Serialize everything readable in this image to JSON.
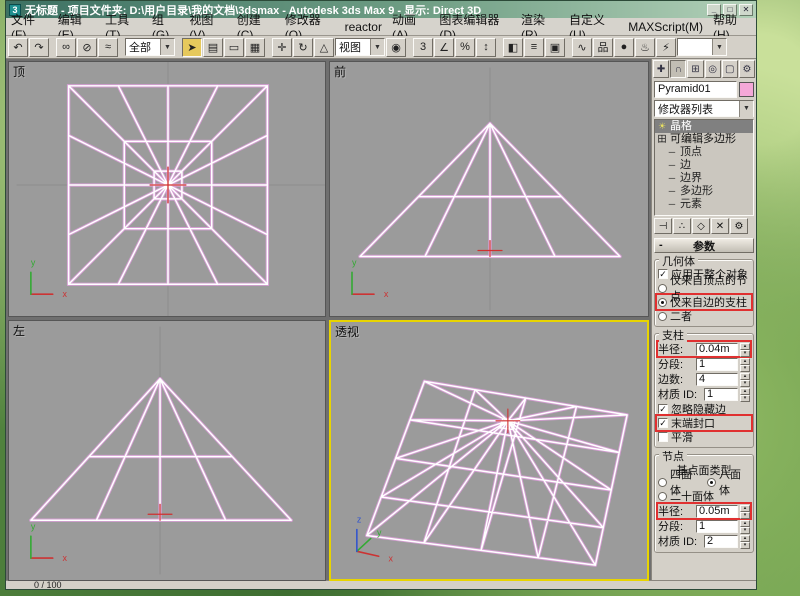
{
  "titlebar": {
    "title": "无标题 - 项目文件夹: D:\\用户目录\\我的文档\\3dsmax    - Autodesk 3ds Max 9 -   显示: Direct 3D",
    "app_icon_glyph": "3"
  },
  "menus": [
    "文件(F)",
    "编辑(E)",
    "工具(T)",
    "组(G)",
    "视图(V)",
    "创建(C)",
    "修改器(O)",
    "reactor",
    "动画(A)",
    "图表编辑器(D)",
    "渲染(R)",
    "自定义(U)",
    "MAXScript(M)",
    "帮助(H)"
  ],
  "toolbar": {
    "items": [
      {
        "type": "btn",
        "name": "undo-icon",
        "glyph": "↶"
      },
      {
        "type": "btn",
        "name": "redo-icon",
        "glyph": "↷"
      },
      {
        "type": "sep"
      },
      {
        "type": "btn",
        "name": "select-link-icon",
        "glyph": "∞"
      },
      {
        "type": "btn",
        "name": "unlink-icon",
        "glyph": "⊘"
      },
      {
        "type": "btn",
        "name": "bind-spacewarp-icon",
        "glyph": "≈"
      },
      {
        "type": "sep"
      },
      {
        "type": "drop",
        "name": "selection-set-dropdown",
        "value": "全部"
      },
      {
        "type": "sep"
      },
      {
        "type": "btn",
        "name": "select-object-icon",
        "glyph": "➤",
        "active": true
      },
      {
        "type": "btn",
        "name": "select-by-name-icon",
        "glyph": "▤"
      },
      {
        "type": "btn",
        "name": "rect-region-icon",
        "glyph": "▭"
      },
      {
        "type": "btn",
        "name": "crossing-icon",
        "glyph": "▦"
      },
      {
        "type": "sep"
      },
      {
        "type": "btn",
        "name": "select-move-icon",
        "glyph": "✛"
      },
      {
        "type": "btn",
        "name": "select-rotate-icon",
        "glyph": "↻"
      },
      {
        "type": "btn",
        "name": "select-scale-icon",
        "glyph": "△"
      },
      {
        "type": "drop",
        "name": "ref-coord-dropdown",
        "value": "视图"
      },
      {
        "type": "btn",
        "name": "use-center-icon",
        "glyph": "◉"
      },
      {
        "type": "sep"
      },
      {
        "type": "btn",
        "name": "snap-3d-icon",
        "glyph": "3"
      },
      {
        "type": "btn",
        "name": "angle-snap-icon",
        "glyph": "∠"
      },
      {
        "type": "btn",
        "name": "percent-snap-icon",
        "glyph": "%"
      },
      {
        "type": "btn",
        "name": "spinner-snap-icon",
        "glyph": "↕"
      },
      {
        "type": "sep"
      },
      {
        "type": "btn",
        "name": "mirror-icon",
        "glyph": "◧"
      },
      {
        "type": "btn",
        "name": "align-icon",
        "glyph": "≡"
      },
      {
        "type": "btn",
        "name": "layer-manager-icon",
        "glyph": "▣"
      },
      {
        "type": "sep"
      },
      {
        "type": "btn",
        "name": "curve-editor-icon",
        "glyph": "∿"
      },
      {
        "type": "btn",
        "name": "schematic-view-icon",
        "glyph": "品"
      },
      {
        "type": "btn",
        "name": "material-editor-icon",
        "glyph": "●"
      },
      {
        "type": "btn",
        "name": "render-scene-icon",
        "glyph": "♨"
      },
      {
        "type": "btn",
        "name": "quick-render-icon",
        "glyph": "⚡"
      },
      {
        "type": "drop",
        "name": "render-type-dropdown",
        "value": ""
      }
    ]
  },
  "viewports": [
    {
      "label": "顶"
    },
    {
      "label": "前"
    },
    {
      "label": "左"
    },
    {
      "label": "透视"
    }
  ],
  "panel": {
    "tabs": [
      {
        "name": "tab-create",
        "glyph": "✚"
      },
      {
        "name": "tab-modify",
        "glyph": "∩",
        "active": true
      },
      {
        "name": "tab-hierarchy",
        "glyph": "⊞"
      },
      {
        "name": "tab-motion",
        "glyph": "◎"
      },
      {
        "name": "tab-display",
        "glyph": "▢"
      },
      {
        "name": "tab-utilities",
        "glyph": "⚙"
      }
    ],
    "object_name": "Pyramid01",
    "modifier_list_label": "修改器列表",
    "stack": [
      {
        "label": "晶格",
        "icon": "bulb",
        "selected": true,
        "indent": 0
      },
      {
        "label": "可编辑多边形",
        "icon": "expand",
        "indent": 0
      },
      {
        "label": "顶点",
        "indent": 1
      },
      {
        "label": "边",
        "indent": 1
      },
      {
        "label": "边界",
        "indent": 1
      },
      {
        "label": "多边形",
        "indent": 1
      },
      {
        "label": "元素",
        "indent": 1
      }
    ],
    "stack_buttons": [
      {
        "name": "pin-stack-button",
        "glyph": "⊣"
      },
      {
        "name": "show-end-result-button",
        "glyph": "∴"
      },
      {
        "name": "make-unique-button",
        "glyph": "◇"
      },
      {
        "name": "remove-modifier-button",
        "glyph": "✕"
      },
      {
        "name": "configure-modifier-button",
        "glyph": "⚙"
      }
    ],
    "rollout_title": "参数",
    "geometry": {
      "title": "几何体",
      "apply_entire": "应用于整个对象",
      "joints_only": "仅来自顶点的节点",
      "struts_only": "仅来自边的支柱",
      "both": "二者"
    },
    "struts": {
      "title": "支柱",
      "radius_label": "半径:",
      "radius_value": "0.04m",
      "segs_label": "分段:",
      "segs_value": "1",
      "sides_label": "边数:",
      "sides_value": "4",
      "matid_label": "材质 ID:",
      "matid_value": "1",
      "ignore_hidden": "忽略隐藏边",
      "end_caps": "末端封口",
      "smooth": "平滑"
    },
    "joints": {
      "title": "节点",
      "basis_label": "基点面类型",
      "tetra": "四面体",
      "octa": "八面体",
      "icosa": "二十面体",
      "radius_label": "半径:",
      "radius_value": "0.05m",
      "segs_label": "分段:",
      "segs_value": "1",
      "matid_label": "材质 ID:",
      "matid_value": "2"
    }
  },
  "status": {
    "frame": "0 / 100"
  },
  "colors": {
    "highlight_annotation": "#e03030",
    "active_viewport_border": "#e8d400",
    "object_color_swatch": "#f4a8d8",
    "wireframe_edge": "#d49ed2",
    "wireframe_core": "#ffffff"
  }
}
